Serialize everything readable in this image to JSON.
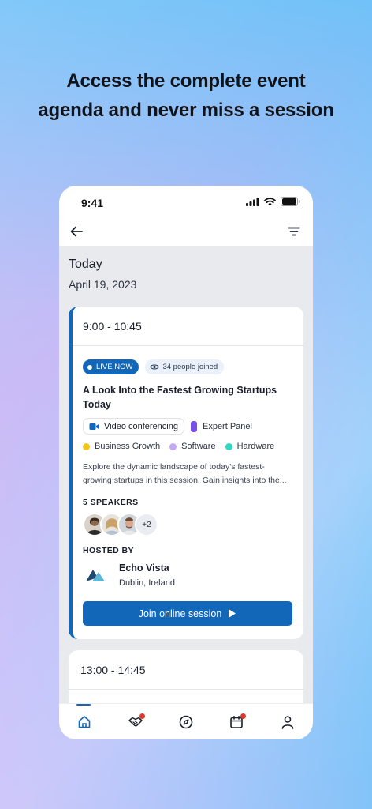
{
  "promo": {
    "line1": "Access the complete event",
    "line2": "agenda and never miss a session"
  },
  "status_bar": {
    "time": "9:41"
  },
  "header": {
    "back_icon": "arrow-left-icon",
    "filter_icon": "filter-icon"
  },
  "date": {
    "title": "Today",
    "subtitle": "April 19, 2023"
  },
  "sessions": [
    {
      "time": "9:00 - 10:45",
      "live_label": "LIVE NOW",
      "joined_label": "34 people joined",
      "title": "A Look Into the Fastest Growing Startups Today",
      "format": "Video conferencing",
      "type": "Expert Panel",
      "topics": [
        {
          "label": "Business Growth",
          "color": "#f5c518"
        },
        {
          "label": "Software",
          "color": "#c3a9f5"
        },
        {
          "label": "Hardware",
          "color": "#2fd8c3"
        }
      ],
      "description": "Explore the dynamic landscape of today's fastest-growing startups in this session. Gain insights into the...",
      "speakers_label": "5 SPEAKERS",
      "speakers_more": "+2",
      "hosted_by_label": "HOSTED BY",
      "host_name": "Echo Vista",
      "host_location": "Dublin, Ireland",
      "join_label": "Join online session"
    },
    {
      "time": "13:00 - 14:45"
    }
  ],
  "tabs": [
    {
      "icon": "home-icon",
      "active": true
    },
    {
      "icon": "handshake-icon",
      "badge": true
    },
    {
      "icon": "compass-icon"
    },
    {
      "icon": "calendar-icon",
      "badge": true
    },
    {
      "icon": "profile-icon"
    }
  ],
  "colors": {
    "accent": "#1267b8",
    "badge_red": "#e0362c",
    "live_badge": "#1267b8"
  }
}
